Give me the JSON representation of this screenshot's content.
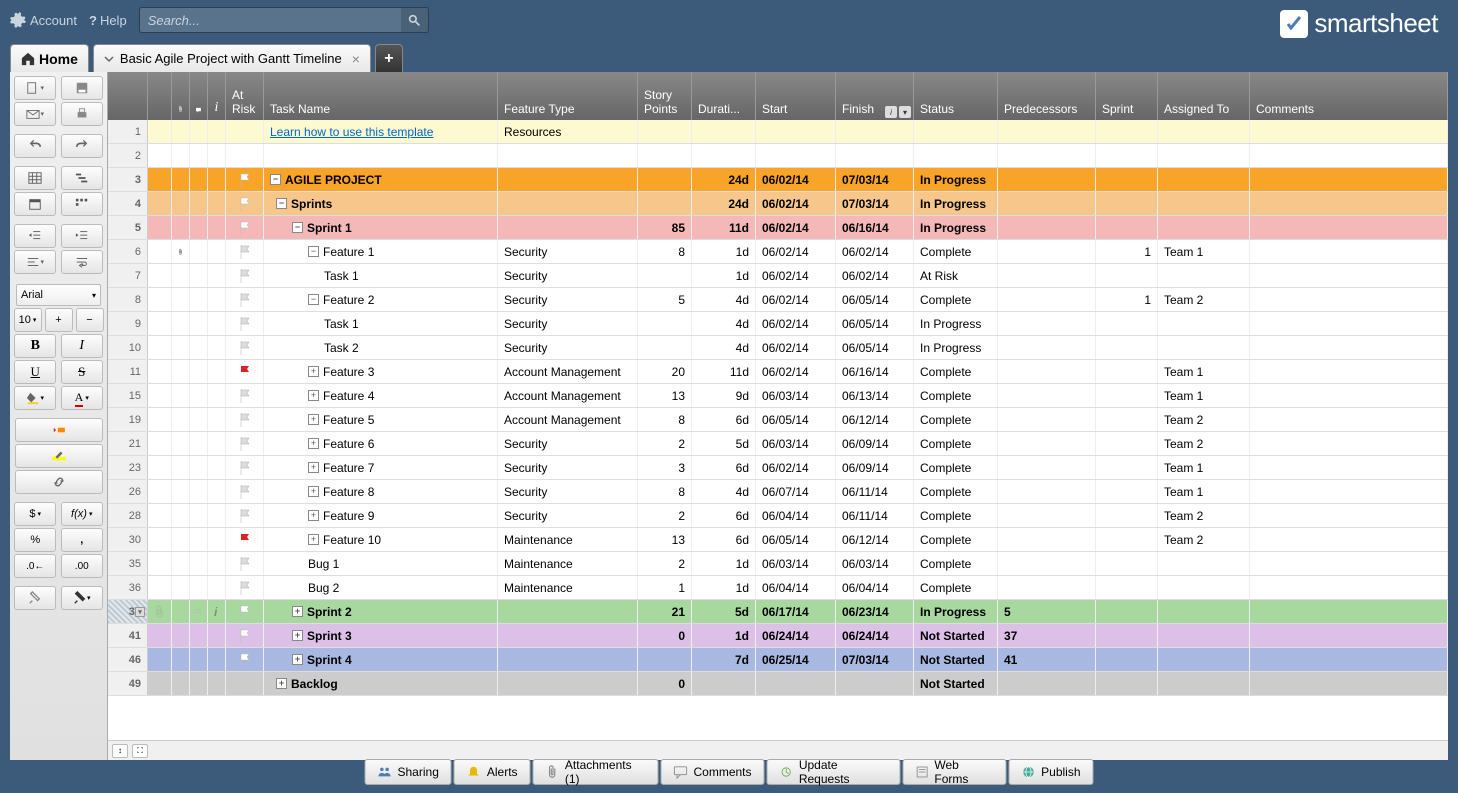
{
  "topbar": {
    "account": "Account",
    "help": "Help",
    "search_placeholder": "Search..."
  },
  "logo": "smartsheet",
  "tabs": {
    "home": "Home",
    "sheet": "Basic Agile Project with Gantt Timeline"
  },
  "toolbar": {
    "font": "Arial",
    "size": "10",
    "plus": "+",
    "minus": "−",
    "bold": "B",
    "italic": "I",
    "underline": "U",
    "strike": "S",
    "currency": "$",
    "fx": "f(x)",
    "percent": "%",
    "comma": ","
  },
  "columns": {
    "atrisk": "At Risk",
    "task": "Task Name",
    "feature": "Feature Type",
    "story": "Story Points",
    "duration": "Durati...",
    "start": "Start",
    "finish": "Finish",
    "status": "Status",
    "predecessors": "Predecessors",
    "sprint": "Sprint",
    "assigned": "Assigned To",
    "comments": "Comments",
    "info_icon": "i"
  },
  "rows": [
    {
      "n": "1",
      "bg": "yellow",
      "task": "Learn how to use this template",
      "link": true,
      "feature": "Resources"
    },
    {
      "n": "2"
    },
    {
      "n": "3",
      "bg": "orange",
      "flag": "white",
      "expand": "−",
      "indent": 0,
      "task": "AGILE PROJECT",
      "dur": "24d",
      "start": "06/02/14",
      "finish": "07/03/14",
      "status": "In Progress"
    },
    {
      "n": "4",
      "bg": "orange2",
      "flag": "white",
      "expand": "−",
      "indent": 1,
      "task": "Sprints",
      "dur": "24d",
      "start": "06/02/14",
      "finish": "07/03/14",
      "status": "In Progress"
    },
    {
      "n": "5",
      "bg": "pink",
      "flag": "white",
      "expand": "−",
      "indent": 2,
      "task": "Sprint 1",
      "story": "85",
      "dur": "11d",
      "start": "06/02/14",
      "finish": "06/16/14",
      "status": "In Progress"
    },
    {
      "n": "6",
      "clip": true,
      "flag": "gray",
      "expand": "−",
      "indent": 3,
      "task": "Feature 1",
      "feature": "Security",
      "story": "8",
      "dur": "1d",
      "start": "06/02/14",
      "finish": "06/02/14",
      "status": "Complete",
      "sprint": "1",
      "assigned": "Team 1"
    },
    {
      "n": "7",
      "flag": "gray",
      "indent": 4,
      "task": "Task 1",
      "feature": "Security",
      "dur": "1d",
      "start": "06/02/14",
      "finish": "06/02/14",
      "status": "At Risk"
    },
    {
      "n": "8",
      "flag": "gray",
      "expand": "−",
      "indent": 3,
      "task": "Feature 2",
      "feature": "Security",
      "story": "5",
      "dur": "4d",
      "start": "06/02/14",
      "finish": "06/05/14",
      "status": "Complete",
      "sprint": "1",
      "assigned": "Team 2"
    },
    {
      "n": "9",
      "flag": "gray",
      "indent": 4,
      "task": "Task 1",
      "feature": "Security",
      "dur": "4d",
      "start": "06/02/14",
      "finish": "06/05/14",
      "status": "In Progress"
    },
    {
      "n": "10",
      "flag": "gray",
      "indent": 4,
      "task": "Task 2",
      "feature": "Security",
      "dur": "4d",
      "start": "06/02/14",
      "finish": "06/05/14",
      "status": "In Progress"
    },
    {
      "n": "11",
      "flag": "red",
      "expand": "+",
      "indent": 3,
      "task": "Feature 3",
      "feature": "Account Management",
      "story": "20",
      "dur": "11d",
      "start": "06/02/14",
      "finish": "06/16/14",
      "status": "Complete",
      "assigned": "Team 1"
    },
    {
      "n": "15",
      "flag": "gray",
      "expand": "+",
      "indent": 3,
      "task": "Feature 4",
      "feature": "Account Management",
      "story": "13",
      "dur": "9d",
      "start": "06/03/14",
      "finish": "06/13/14",
      "status": "Complete",
      "assigned": "Team 1"
    },
    {
      "n": "19",
      "flag": "gray",
      "expand": "+",
      "indent": 3,
      "task": "Feature 5",
      "feature": "Account Management",
      "story": "8",
      "dur": "6d",
      "start": "06/05/14",
      "finish": "06/12/14",
      "status": "Complete",
      "assigned": "Team 2"
    },
    {
      "n": "21",
      "flag": "gray",
      "expand": "+",
      "indent": 3,
      "task": "Feature 6",
      "feature": "Security",
      "story": "2",
      "dur": "5d",
      "start": "06/03/14",
      "finish": "06/09/14",
      "status": "Complete",
      "assigned": "Team 2"
    },
    {
      "n": "23",
      "flag": "gray",
      "expand": "+",
      "indent": 3,
      "task": "Feature 7",
      "feature": "Security",
      "story": "3",
      "dur": "6d",
      "start": "06/02/14",
      "finish": "06/09/14",
      "status": "Complete",
      "assigned": "Team 1"
    },
    {
      "n": "26",
      "flag": "gray",
      "expand": "+",
      "indent": 3,
      "task": "Feature 8",
      "feature": "Security",
      "story": "8",
      "dur": "4d",
      "start": "06/07/14",
      "finish": "06/11/14",
      "status": "Complete",
      "assigned": "Team 1"
    },
    {
      "n": "28",
      "flag": "gray",
      "expand": "+",
      "indent": 3,
      "task": "Feature 9",
      "feature": "Security",
      "story": "2",
      "dur": "6d",
      "start": "06/04/14",
      "finish": "06/11/14",
      "status": "Complete",
      "assigned": "Team 2"
    },
    {
      "n": "30",
      "flag": "red",
      "expand": "+",
      "indent": 3,
      "task": "Feature 10",
      "feature": "Maintenance",
      "story": "13",
      "dur": "6d",
      "start": "06/05/14",
      "finish": "06/12/14",
      "status": "Complete",
      "assigned": "Team 2"
    },
    {
      "n": "35",
      "flag": "gray",
      "indent": 3,
      "task": "Bug 1",
      "feature": "Maintenance",
      "story": "2",
      "dur": "1d",
      "start": "06/03/14",
      "finish": "06/03/14",
      "status": "Complete"
    },
    {
      "n": "36",
      "flag": "gray",
      "indent": 3,
      "task": "Bug 2",
      "feature": "Maintenance",
      "story": "1",
      "dur": "1d",
      "start": "06/04/14",
      "finish": "06/04/14",
      "status": "Complete"
    },
    {
      "n": "37",
      "sel": true,
      "bg": "green",
      "flag": "white",
      "expand": "+",
      "indent": 2,
      "task": "Sprint 2",
      "story": "21",
      "dur": "5d",
      "start": "06/17/14",
      "finish": "06/23/14",
      "status": "In Progress",
      "pred": "5"
    },
    {
      "n": "41",
      "bg": "purple",
      "flag": "white",
      "expand": "+",
      "indent": 2,
      "task": "Sprint 3",
      "story": "0",
      "dur": "1d",
      "start": "06/24/14",
      "finish": "06/24/14",
      "status": "Not Started",
      "pred": "37"
    },
    {
      "n": "46",
      "bg": "blue",
      "flag": "white",
      "expand": "+",
      "indent": 2,
      "task": "Sprint 4",
      "dur": "7d",
      "start": "06/25/14",
      "finish": "07/03/14",
      "status": "Not Started",
      "pred": "41"
    },
    {
      "n": "49",
      "bg": "gray",
      "expand": "+",
      "indent": 1,
      "task": "Backlog",
      "story": "0",
      "status": "Not Started"
    }
  ],
  "bottom": {
    "sharing": "Sharing",
    "alerts": "Alerts",
    "attachments": "Attachments (1)",
    "comments": "Comments",
    "updates": "Update Requests",
    "webforms": "Web Forms",
    "publish": "Publish"
  }
}
